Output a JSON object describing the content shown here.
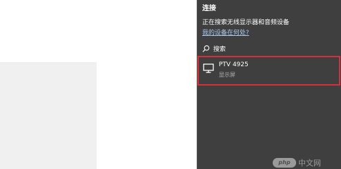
{
  "connect_pane": {
    "title": "连接",
    "status": "正在搜索无线显示器和音频设备",
    "help_link": "我的设备在何处?",
    "search_label": "搜索",
    "devices": [
      {
        "name": "PTV 4925",
        "type": "显示屏"
      }
    ]
  },
  "watermark": {
    "logo_text": "php",
    "site_text": "中文网"
  },
  "colors": {
    "pane_bg": "#3f3f3f",
    "link": "#a8c8ec",
    "highlight_border": "#d6303a",
    "left_panel": "#f0f0f0"
  }
}
